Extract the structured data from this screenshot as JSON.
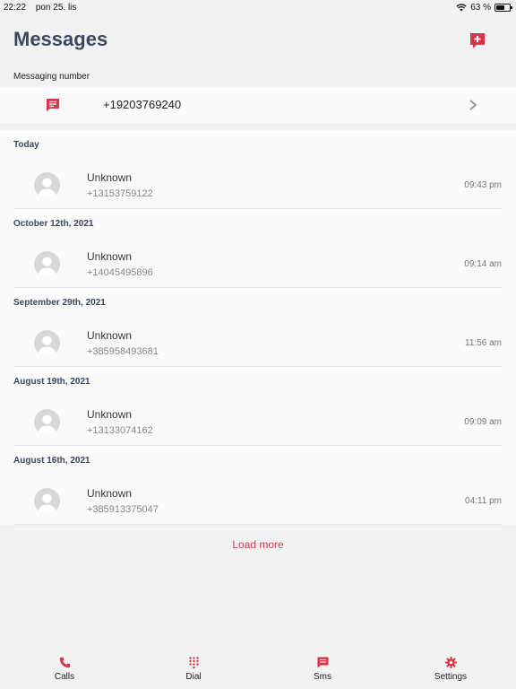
{
  "status_bar": {
    "time": "22:22",
    "date": "pon 25. lis",
    "battery": "63 %",
    "battery_level": 0.63
  },
  "header": {
    "title": "Messages"
  },
  "messaging_number": {
    "label": "Messaging number",
    "number": "+19203769240"
  },
  "groups": [
    {
      "header": "Today",
      "items": [
        {
          "name": "Unknown",
          "phone": "+13153759122",
          "time": "09:43 pm"
        }
      ]
    },
    {
      "header": "October 12th, 2021",
      "items": [
        {
          "name": "Unknown",
          "phone": "+14045495896",
          "time": "09:14 am"
        }
      ]
    },
    {
      "header": "September 29th, 2021",
      "items": [
        {
          "name": "Unknown",
          "phone": "+385958493681",
          "time": "11:56 am"
        }
      ]
    },
    {
      "header": "August 19th, 2021",
      "items": [
        {
          "name": "Unknown",
          "phone": "+13133074162",
          "time": "09:09 am"
        }
      ]
    },
    {
      "header": "August 16th, 2021",
      "items": [
        {
          "name": "Unknown",
          "phone": "+385913375047",
          "time": "04:11 pm"
        }
      ]
    }
  ],
  "load_more": "Load more",
  "tabs": [
    {
      "label": "Calls",
      "icon": "phone-icon"
    },
    {
      "label": "Dial",
      "icon": "dialpad-icon"
    },
    {
      "label": "Sms",
      "icon": "sms-icon"
    },
    {
      "label": "Settings",
      "icon": "gear-icon"
    }
  ],
  "colors": {
    "accent": "#d8364a",
    "title": "#3c4760"
  }
}
